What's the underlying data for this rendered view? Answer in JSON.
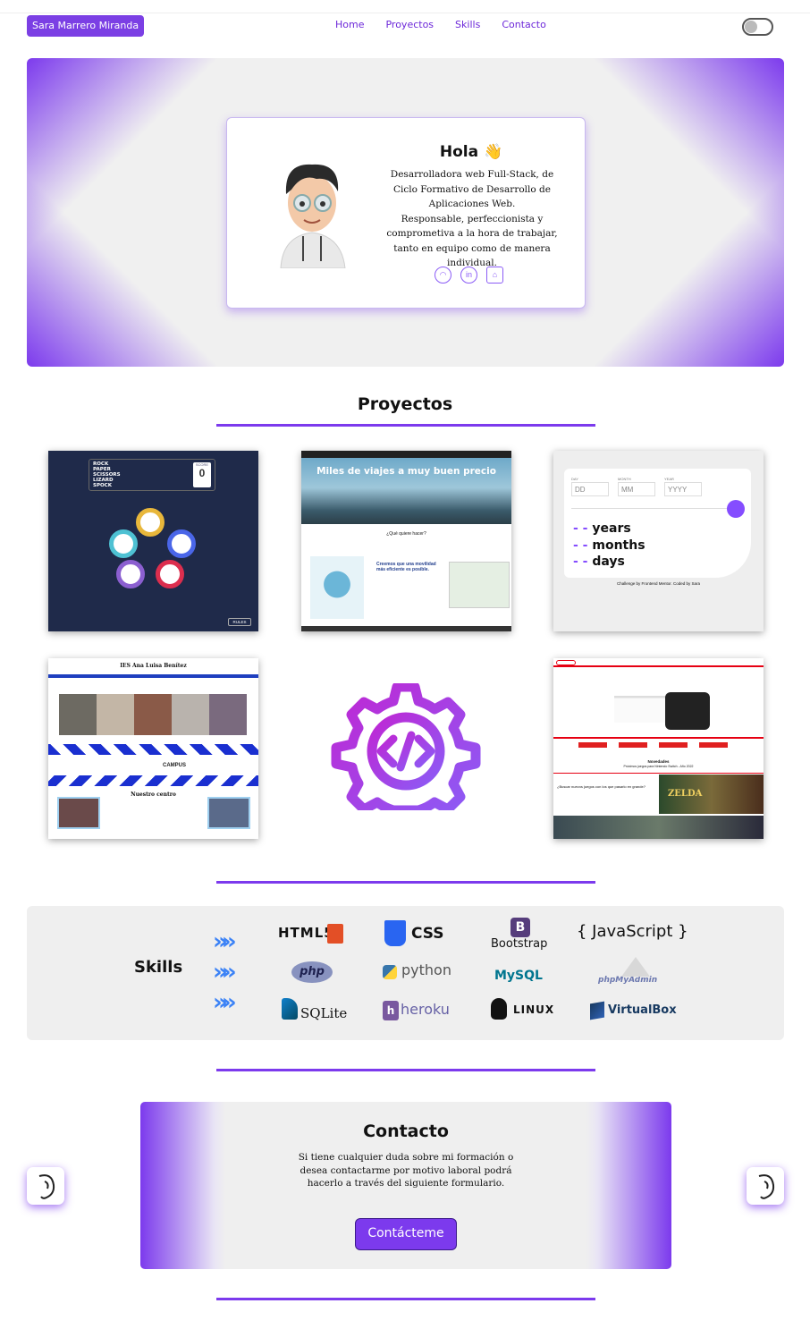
{
  "nav": {
    "brand": "Sara Marrero Miranda",
    "links": [
      "Home",
      "Proyectos",
      "Skills",
      "Contacto"
    ]
  },
  "hero": {
    "greeting": "Hola 👋",
    "description_1": "Desarrolladora web Full-Stack, de Ciclo Formativo de Desarrollo de Aplicaciones Web.",
    "description_2": "Responsable, perfeccionista y comprometiva a la hora de trabajar, tanto en equipo como de manera individual.",
    "social_icons": [
      "github-icon",
      "linkedin-icon",
      "store-icon"
    ]
  },
  "projects": {
    "title": "Proyectos",
    "p1": {
      "lines": [
        "ROCK",
        "PAPER",
        "SCISSORS",
        "LIZARD",
        "SPOCK"
      ],
      "score_label": "SCORE",
      "score": "0",
      "button": "RULES"
    },
    "p2": {
      "headline": "Miles de viajes a muy buen precio",
      "question": "¿Qué quiere hacer?",
      "subhead": "Creemos que una movilidad más eficiente es posible."
    },
    "p3": {
      "day_label": "DAY",
      "month_label": "MONTH",
      "year_label": "YEAR",
      "day_ph": "DD",
      "month_ph": "MM",
      "year_ph": "YYYY",
      "years": "years",
      "months": "months",
      "days": "days",
      "dashes": "- -",
      "credit": "Challenge by Frontend Mentor. Coded by Sara"
    },
    "p4": {
      "school": "IES Ana Luisa Benítez",
      "campus": "CAMPUS",
      "section": "Nuestro centro"
    },
    "p6": {
      "novedades": "Novedades",
      "subtitle": "Próximos juegos para Nintendo Switch - Año 2022",
      "text": "¿Buscar nuevos juegos con los que pasarlo en grande?",
      "zelda": "ZELDA"
    }
  },
  "skills": {
    "title": "Skills",
    "chevrons": "»",
    "logos": [
      "HTML5",
      "CSS",
      "Bootstrap",
      "{ JavaScript }",
      "php",
      "python",
      "MySQL",
      "phpMyAdmin",
      "SQLite",
      "heroku",
      "LINUX",
      "VirtualBox"
    ]
  },
  "contact": {
    "title": "Contacto",
    "text": "Si tiene cualquier duda sobre mi formación o desea contactarme por motivo laboral podrá hacerlo a través del siguiente formulario.",
    "button": "Contácteme"
  },
  "colors": {
    "accent": "#7c3aed",
    "skills_chevron": "#3b82f6"
  }
}
